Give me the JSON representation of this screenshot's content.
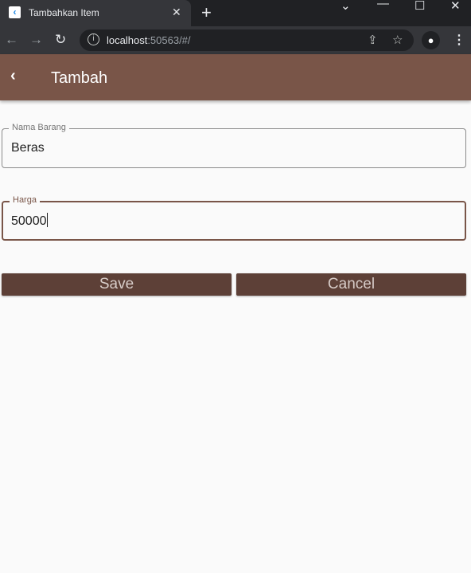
{
  "browser": {
    "tab_title": "Tambahkan Item",
    "url_host": "localhost",
    "url_rest": ":50563/#/"
  },
  "app": {
    "title": "Tambah",
    "accent_color": "#795548",
    "button_color": "#5d4037"
  },
  "form": {
    "nama_label": "Nama Barang",
    "nama_value": "Beras",
    "harga_label": "Harga",
    "harga_value": "50000",
    "save_label": "Save",
    "cancel_label": "Cancel"
  }
}
